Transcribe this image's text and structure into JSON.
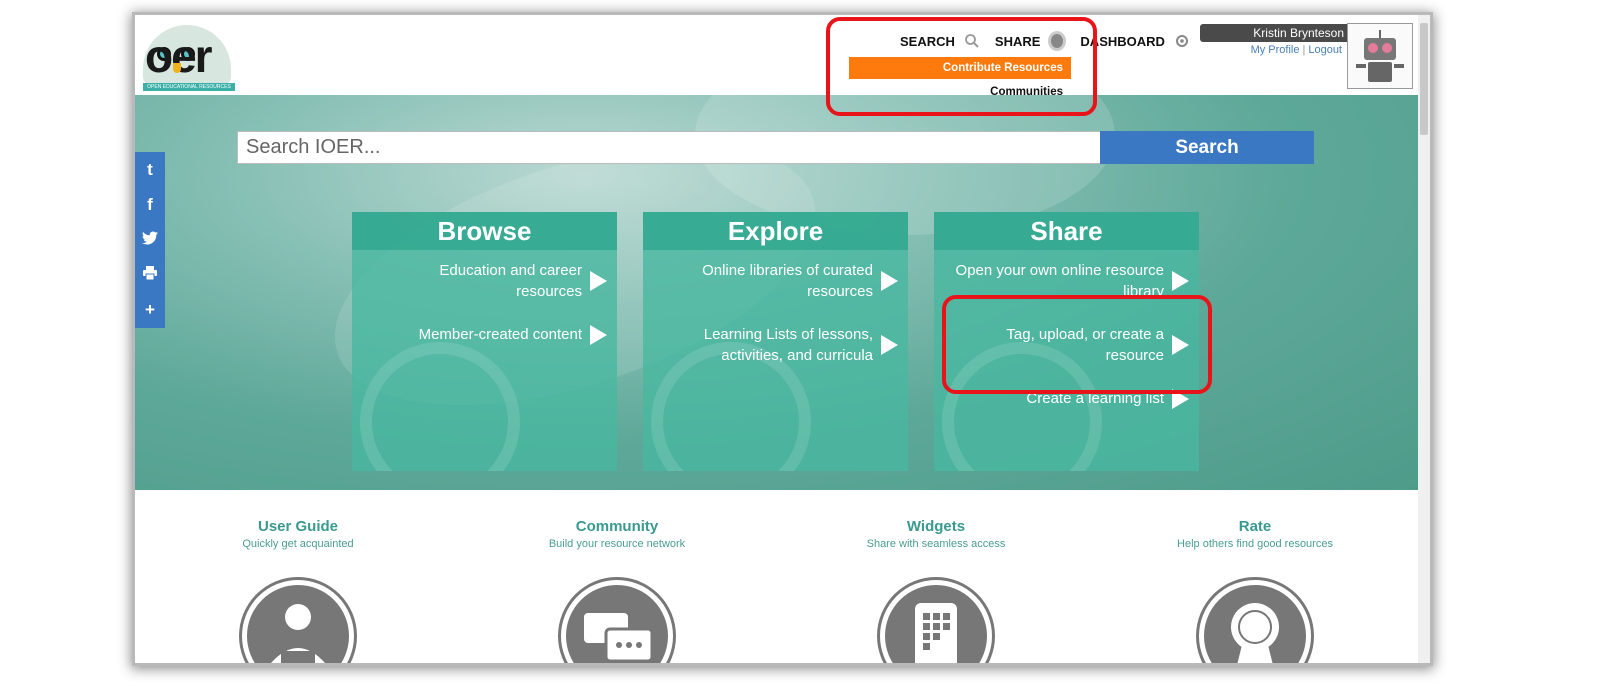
{
  "header": {
    "logo_text": "oer",
    "logo_strip": "OPEN EDUCATIONAL RESOURCES",
    "nav": [
      {
        "label": "SEARCH",
        "icon": "search-icon"
      },
      {
        "label": "SHARE",
        "icon": "share-icon"
      },
      {
        "label": "DASHBOARD",
        "icon": "dashboard-icon"
      }
    ],
    "dropdown": {
      "contribute": "Contribute Resources",
      "communities": "Communities"
    },
    "user": {
      "name": "Kristin Brynteson",
      "profile_link": "My Profile",
      "logout_link": "Logout"
    }
  },
  "search": {
    "placeholder": "Search IOER...",
    "button": "Search"
  },
  "social": [
    "t",
    "f",
    "twitter-icon",
    "print-icon",
    "+"
  ],
  "cards": [
    {
      "title": "Browse",
      "links": [
        "Education and career resources",
        "Member-created content"
      ]
    },
    {
      "title": "Explore",
      "links": [
        "Online libraries of curated resources",
        "Learning Lists of lessons, activities, and curricula"
      ]
    },
    {
      "title": "Share",
      "links": [
        "Open your own online resource library",
        "Tag, upload, or create a resource",
        "Create a learning list"
      ]
    }
  ],
  "features": [
    {
      "title": "User Guide",
      "subtitle": "Quickly get acquainted",
      "icon": "reader-icon"
    },
    {
      "title": "Community",
      "subtitle": "Build your resource network",
      "icon": "chat-icon"
    },
    {
      "title": "Widgets",
      "subtitle": "Share with seamless access",
      "icon": "widget-grid-icon"
    },
    {
      "title": "Rate",
      "subtitle": "Help others find good resources",
      "icon": "award-icon"
    }
  ],
  "colors": {
    "accent_blue": "#3a78c4",
    "accent_orange": "#ff7a0d",
    "highlight_red": "#e8141a",
    "teal": "#3a9a90"
  }
}
